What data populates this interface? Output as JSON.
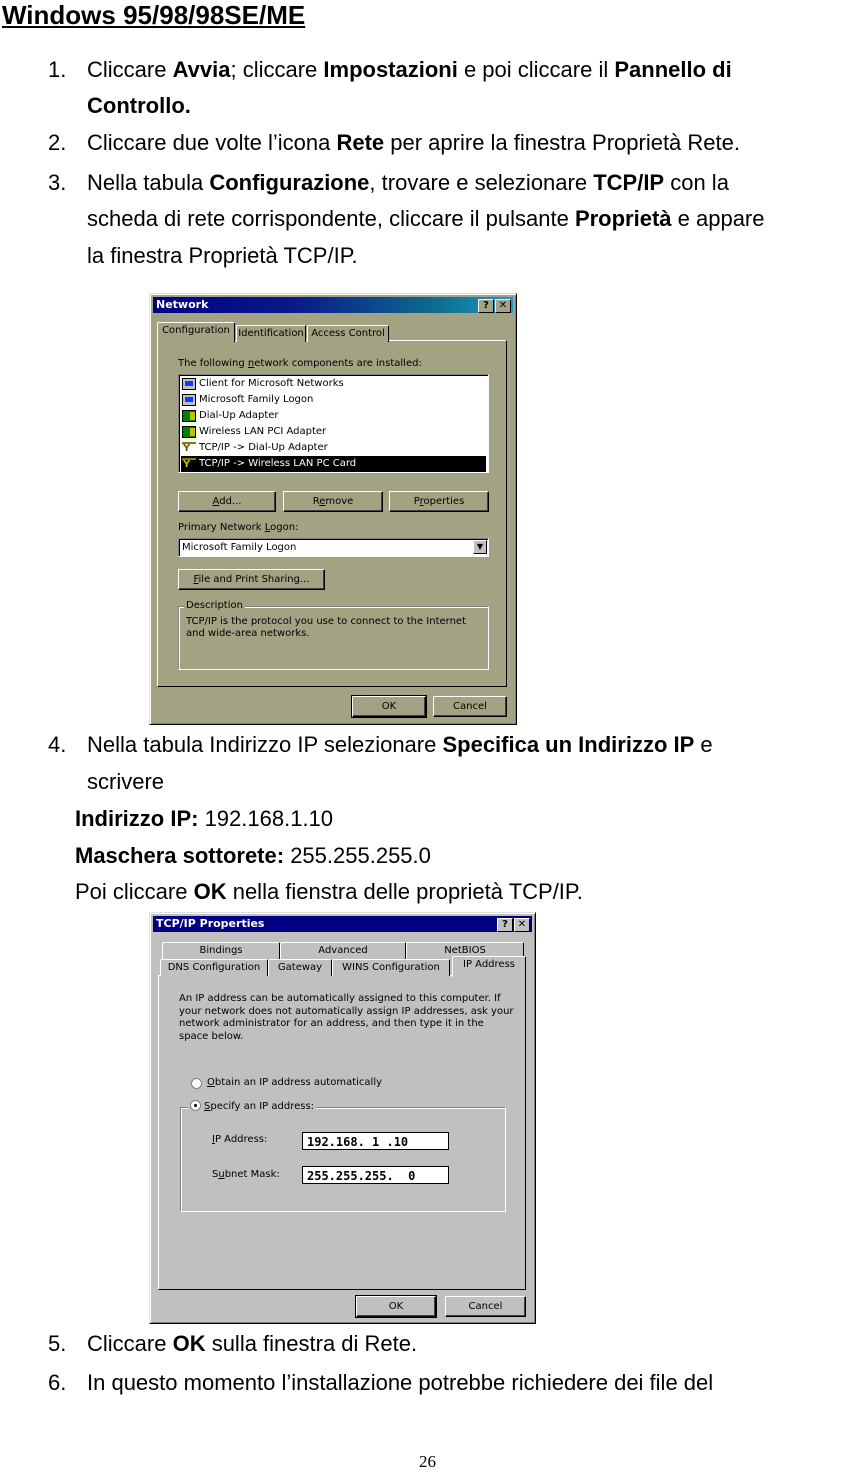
{
  "heading": "Windows 95/98/98SE/ME",
  "steps": [
    {
      "num": "1.",
      "parts": [
        "Cliccare ",
        "Avvia",
        "; cliccare ",
        "Impostazioni",
        " e poi cliccare il ",
        "Pannello di",
        "Controllo."
      ]
    },
    {
      "num": "2.",
      "parts": [
        "Cliccare due volte l’icona ",
        "Rete",
        " per aprire la finestra Proprietà Rete."
      ]
    },
    {
      "num": "3.",
      "parts": [
        "Nella tabula ",
        "Configurazione",
        ", trovare e selezionare ",
        "TCP/IP",
        " con la",
        "scheda di rete corrispondente, cliccare il pulsante ",
        "Proprietà",
        " e appare",
        "la finestra Proprietà TCP/IP."
      ]
    },
    {
      "num": "4.",
      "parts": [
        "Nella tabula Indirizzo IP selezionare ",
        "Specifica un Indirizzo IP",
        " e",
        "scrivere"
      ]
    },
    {
      "num": "5.",
      "parts": [
        "Cliccare ",
        "OK",
        " sulla finestra di Rete."
      ]
    },
    {
      "num": "6.",
      "parts": [
        "In questo momento l’installazione potrebbe richiedere dei file del"
      ]
    }
  ],
  "step4_details": {
    "ip_label": "Indirizzo IP:",
    "ip_value": " 192.168.1.10",
    "mask_label": "Maschera sottorete:",
    "mask_value": " 255.255.255.0",
    "poi_pre": "Poi cliccare ",
    "poi_ok": "OK",
    "poi_post": " nella fienstra delle proprietà TCP/IP."
  },
  "network_dialog": {
    "title": "Network",
    "help_btn": "?",
    "close_btn": "✕",
    "tabs": [
      "Configuration",
      "Identification",
      "Access Control"
    ],
    "components_label_pre": "The following ",
    "components_label_u": "n",
    "components_label_post": "etwork components are installed:",
    "components": [
      {
        "icon": "client-icon",
        "label": "Client for Microsoft Networks",
        "selected": false
      },
      {
        "icon": "client-icon",
        "label": "Microsoft Family Logon",
        "selected": false
      },
      {
        "icon": "adapter-icon",
        "label": "Dial-Up Adapter",
        "selected": false
      },
      {
        "icon": "adapter-icon",
        "label": "Wireless LAN PCI Adapter",
        "selected": false
      },
      {
        "icon": "protocol-icon",
        "label": "TCP/IP -> Dial-Up Adapter",
        "selected": false
      },
      {
        "icon": "protocol-icon",
        "label": "TCP/IP -> Wireless LAN  PC Card",
        "selected": true
      }
    ],
    "add_btn_u": "A",
    "add_btn": "dd...",
    "remove_btn_pre": "R",
    "remove_btn_u": "e",
    "remove_btn": "move",
    "props_btn_pre": "P",
    "props_btn_u": "r",
    "props_btn": "operties",
    "logon_label_pre": "Primary Network ",
    "logon_label_u": "L",
    "logon_label_post": "ogon:",
    "logon_value": "Microsoft Family Logon",
    "combo_arrow": "▼",
    "share_btn_u": "F",
    "share_btn": "ile and Print Sharing...",
    "description_legend": "Description",
    "description_text": "TCP/IP is the protocol you use to connect to the Internet and wide-area networks.",
    "ok_btn": "OK",
    "cancel_btn": "Cancel"
  },
  "tcpip_dialog": {
    "title": "TCP/IP Properties",
    "help_btn": "?",
    "close_btn": "✕",
    "tabs_back": [
      "Bindings",
      "Advanced",
      "NetBIOS"
    ],
    "tabs_front": [
      "DNS Configuration",
      "Gateway",
      "WINS Configuration",
      "IP Address"
    ],
    "active_tab": "IP Address",
    "intro_text": "An IP address can be automatically assigned to this computer. If your network does not automatically assign IP addresses, ask your network administrator for an address, and then type it in the space below.",
    "radio_auto_u": "O",
    "radio_auto": "btain an IP address automatically",
    "radio_specify_u": "S",
    "radio_specify": "pecify an IP address:",
    "selected_radio": "specify",
    "ip_label_u": "I",
    "ip_label": "P Address:",
    "ip_value": "192.168. 1 .10",
    "mask_label_pre": "S",
    "mask_label_u": "u",
    "mask_label": "bnet Mask:",
    "mask_value": "255.255.255.  0",
    "ok_btn": "OK",
    "cancel_btn": "Cancel"
  },
  "page_number": "26"
}
